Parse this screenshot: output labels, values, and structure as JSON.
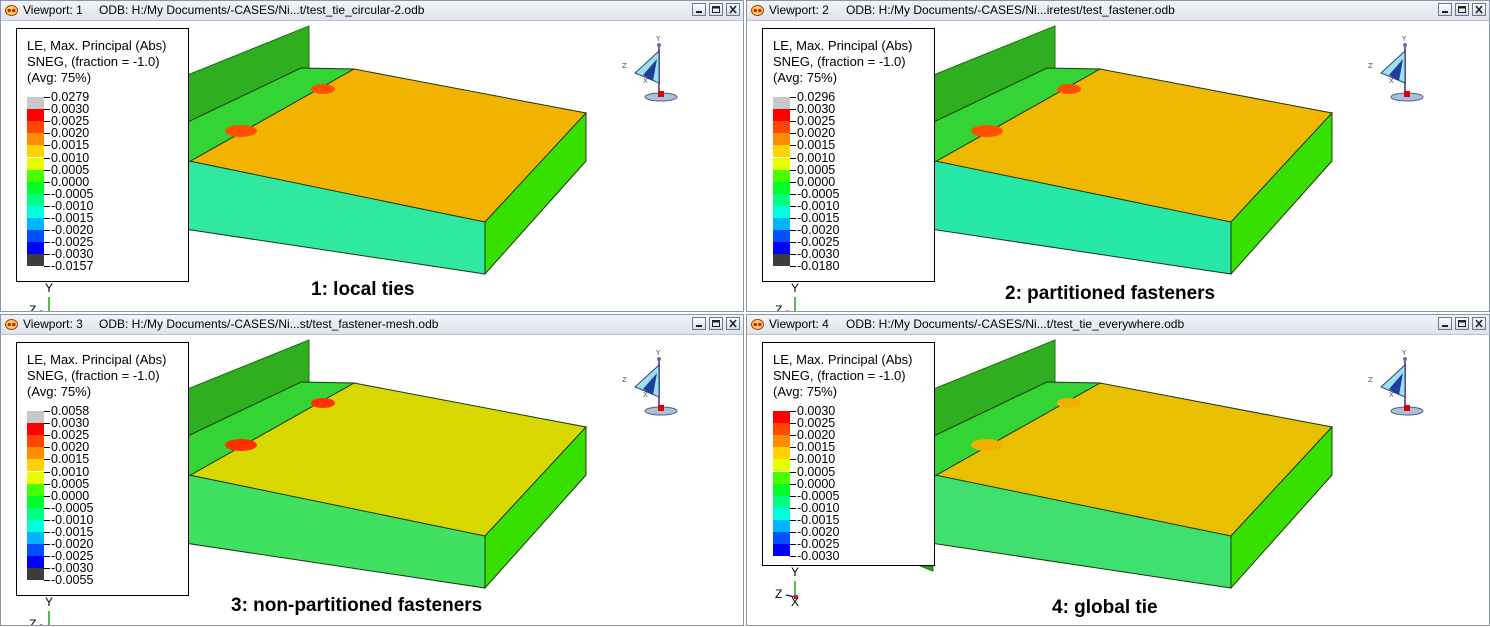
{
  "legend_title": [
    "LE, Max. Principal (Abs)",
    "SNEG, (fraction = -1.0)",
    "(Avg: 75%)"
  ],
  "colors": {
    "grey_top": "#c8c8c8",
    "red": "#ff0000",
    "red_orange": "#ff4600",
    "orange": "#ff8c00",
    "yellow_orange": "#ffd200",
    "yellow": "#e6ff00",
    "yellow_green": "#a0ff00",
    "green": "#46ff00",
    "green2": "#00ff28",
    "green_cyan": "#00ff82",
    "cyan": "#00ffdc",
    "cyan_blue": "#00b4ff",
    "blue": "#0050ff",
    "deep_blue": "#0000ff",
    "black_bottom": "#3c3c3c"
  },
  "viewports": [
    {
      "label": "Viewport: 1",
      "odb": "ODB: H:/My Documents/-CASES/Ni...t/test_tie_circular-2.odb",
      "caption": "1: local ties",
      "legend_values": [
        "0.0279",
        "0.0030",
        "0.0025",
        "0.0020",
        "0.0015",
        "0.0010",
        "0.0005",
        "0.0000",
        "-0.0005",
        "-0.0010",
        "-0.0015",
        "-0.0020",
        "-0.0025",
        "-0.0030",
        "-0.0157"
      ],
      "swatches": [
        "grey_top",
        "red",
        "red_orange",
        "orange",
        "yellow_orange",
        "yellow",
        "green",
        "green2",
        "green_cyan",
        "cyan",
        "cyan_blue",
        "blue",
        "deep_blue",
        "black_bottom"
      ]
    },
    {
      "label": "Viewport: 2",
      "odb": "ODB: H:/My Documents/-CASES/Ni...iretest/test_fastener.odb",
      "caption": "2: partitioned fasteners",
      "legend_values": [
        "0.0296",
        "0.0030",
        "0.0025",
        "0.0020",
        "0.0015",
        "0.0010",
        "0.0005",
        "0.0000",
        "-0.0005",
        "-0.0010",
        "-0.0015",
        "-0.0020",
        "-0.0025",
        "-0.0030",
        "-0.0180"
      ],
      "swatches": [
        "grey_top",
        "red",
        "red_orange",
        "orange",
        "yellow_orange",
        "yellow",
        "green",
        "green2",
        "green_cyan",
        "cyan",
        "cyan_blue",
        "blue",
        "deep_blue",
        "black_bottom"
      ]
    },
    {
      "label": "Viewport: 3",
      "odb": "ODB: H:/My Documents/-CASES/Ni...st/test_fastener-mesh.odb",
      "caption": "3: non-partitioned fasteners",
      "legend_values": [
        "0.0058",
        "0.0030",
        "0.0025",
        "0.0020",
        "0.0015",
        "0.0010",
        "0.0005",
        "0.0000",
        "-0.0005",
        "-0.0010",
        "-0.0015",
        "-0.0020",
        "-0.0025",
        "-0.0030",
        "-0.0055"
      ],
      "swatches": [
        "grey_top",
        "red",
        "red_orange",
        "orange",
        "yellow_orange",
        "yellow",
        "green",
        "green2",
        "green_cyan",
        "cyan",
        "cyan_blue",
        "blue",
        "deep_blue",
        "black_bottom"
      ]
    },
    {
      "label": "Viewport: 4",
      "odb": "ODB: H:/My Documents/-CASES/Ni...t/test_tie_everywhere.odb",
      "caption": "4: global tie",
      "legend_values": [
        "0.0030",
        "0.0025",
        "0.0020",
        "0.0015",
        "0.0010",
        "0.0005",
        "0.0000",
        "-0.0005",
        "-0.0010",
        "-0.0015",
        "-0.0020",
        "-0.0025",
        "-0.0030"
      ],
      "swatches": [
        "red",
        "red_orange",
        "orange",
        "yellow_orange",
        "yellow",
        "green",
        "green2",
        "green_cyan",
        "cyan",
        "cyan_blue",
        "blue",
        "deep_blue"
      ]
    }
  ],
  "triad_axes": {
    "y": "Y",
    "z": "Z",
    "x": "X"
  }
}
